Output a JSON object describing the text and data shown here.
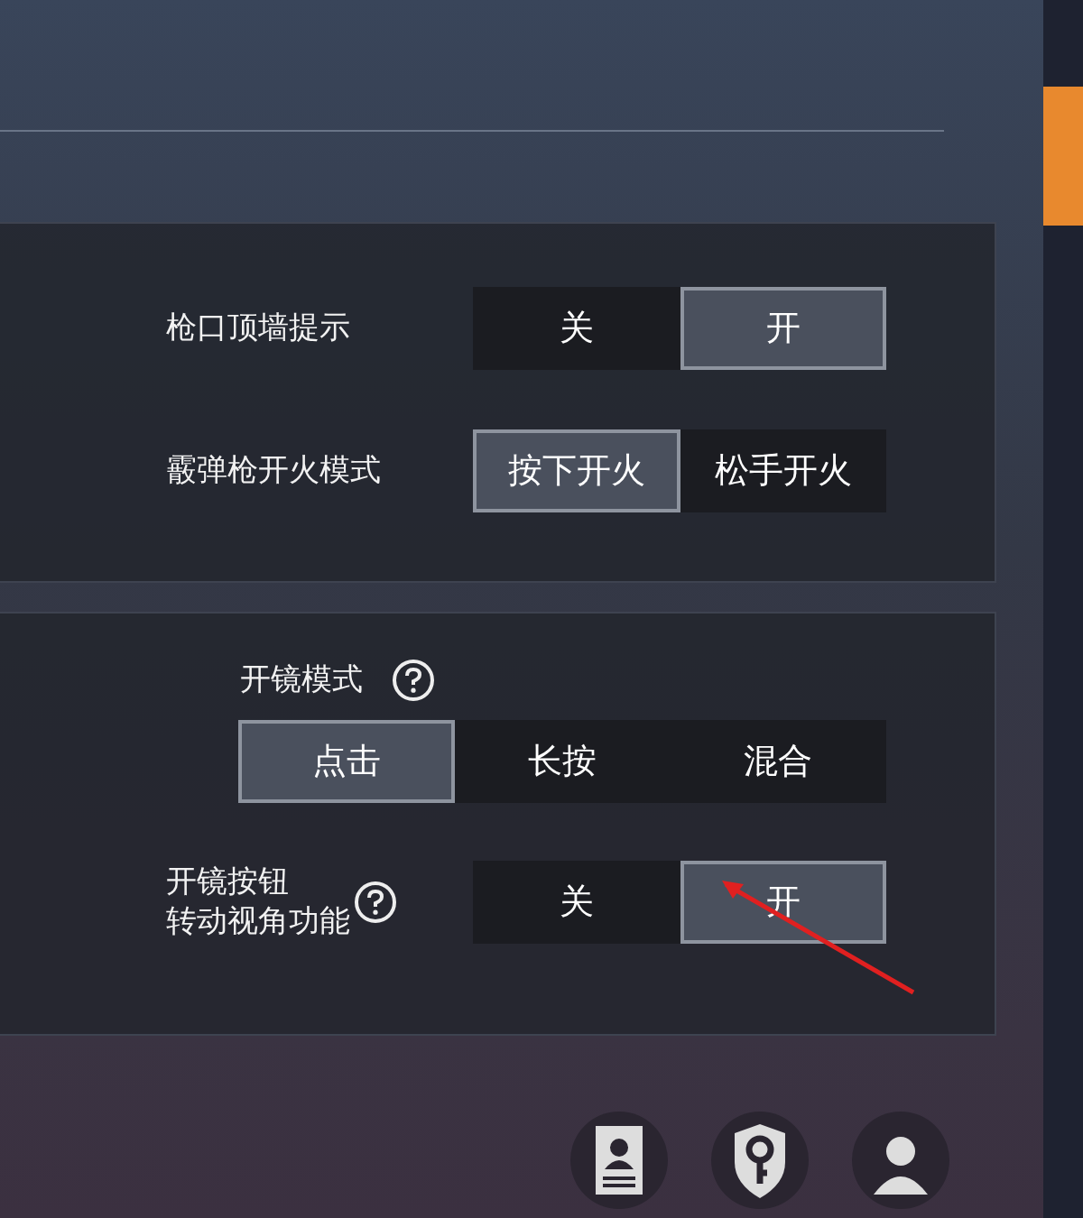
{
  "sections": [
    {
      "rows": [
        {
          "kind": "inline",
          "label": [
            "枪口顶墙提示"
          ],
          "help": false,
          "options": [
            {
              "label": "关",
              "selected": false
            },
            {
              "label": "开",
              "selected": true
            }
          ]
        },
        {
          "kind": "inline",
          "label": [
            "霰弹枪开火模式"
          ],
          "help": false,
          "options": [
            {
              "label": "按下开火",
              "selected": true
            },
            {
              "label": "松手开火",
              "selected": false
            }
          ]
        }
      ]
    },
    {
      "rows": [
        {
          "kind": "stacked",
          "label": [
            "开镜模式"
          ],
          "help": true,
          "options": [
            {
              "label": "点击",
              "selected": true
            },
            {
              "label": "长按",
              "selected": false
            },
            {
              "label": "混合",
              "selected": false
            }
          ]
        },
        {
          "kind": "inline",
          "label": [
            "开镜按钮",
            "转动视角功能"
          ],
          "help": true,
          "options": [
            {
              "label": "关",
              "selected": false
            },
            {
              "label": "开",
              "selected": true
            }
          ]
        }
      ]
    }
  ]
}
